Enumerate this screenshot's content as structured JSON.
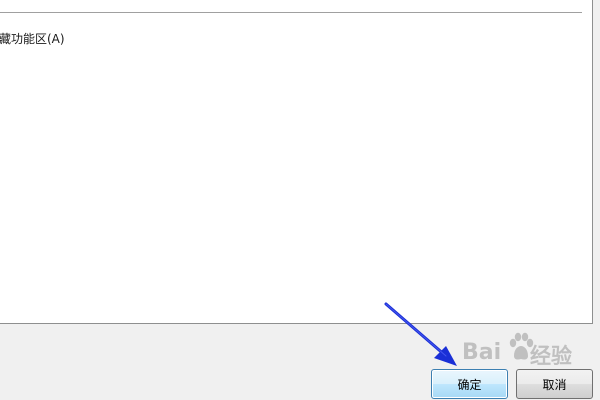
{
  "dialog": {
    "option_label": "藏功能区(A)",
    "ok_label": "确定",
    "cancel_label": "取消"
  },
  "watermark": {
    "brand_left": "Bai",
    "brand_right": "经验"
  },
  "colors": {
    "panel_bg": "#ffffff",
    "dialog_bg": "#f0f0f0",
    "ok_border": "#3c7fb1",
    "arrow": "#1a2fd6"
  },
  "icons": [
    "baidu-paw-icon",
    "arrow-icon"
  ]
}
